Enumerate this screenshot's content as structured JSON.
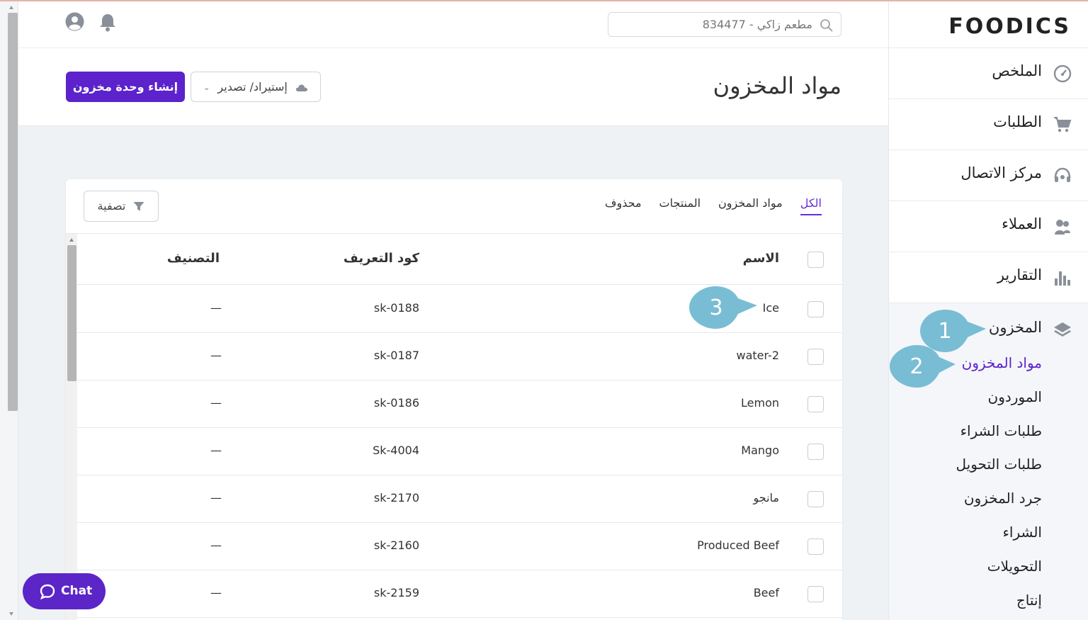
{
  "app": {
    "logo": "FOODICS",
    "search_value": "مطعم زاكي - 834477"
  },
  "page": {
    "title": "مواد المخزون",
    "create_button": "إنشاء وحدة مخزون",
    "import_export_button": "إستيراد/ تصدير",
    "filter_button": "تصفية"
  },
  "tabs": [
    {
      "label": "الكل",
      "active": true
    },
    {
      "label": "مواد المخزون",
      "active": false
    },
    {
      "label": "المنتجات",
      "active": false
    },
    {
      "label": "محذوف",
      "active": false
    }
  ],
  "table": {
    "columns": {
      "name": "الاسم",
      "sku": "كود التعريف",
      "category": "التصنيف"
    },
    "rows": [
      {
        "name": "Ice",
        "sku": "sk-0188",
        "category": "—"
      },
      {
        "name": "water-2",
        "sku": "sk-0187",
        "category": "—"
      },
      {
        "name": "Lemon",
        "sku": "sk-0186",
        "category": "—"
      },
      {
        "name": "Mango",
        "sku": "Sk-4004",
        "category": "—"
      },
      {
        "name": "مانجو",
        "sku": "sk-2170",
        "category": "—"
      },
      {
        "name": "Produced Beef",
        "sku": "sk-2160",
        "category": "—"
      },
      {
        "name": "Beef",
        "sku": "sk-2159",
        "category": "—"
      }
    ]
  },
  "sidebar": {
    "items": [
      {
        "label": "الملخص",
        "icon": "dashboard-icon"
      },
      {
        "label": "الطلبات",
        "icon": "cart-icon"
      },
      {
        "label": "مركز الاتصال",
        "icon": "headset-icon"
      },
      {
        "label": "العملاء",
        "icon": "customers-icon"
      },
      {
        "label": "التقارير",
        "icon": "reports-icon"
      }
    ],
    "inventory": {
      "label": "المخزون",
      "icon": "layers-icon",
      "subitems": [
        {
          "label": "مواد المخزون",
          "active": true
        },
        {
          "label": "الموردون",
          "active": false
        },
        {
          "label": "طلبات الشراء",
          "active": false
        },
        {
          "label": "طلبات التحويل",
          "active": false
        },
        {
          "label": "جرد المخزون",
          "active": false
        },
        {
          "label": "الشراء",
          "active": false
        },
        {
          "label": "التحويلات",
          "active": false
        },
        {
          "label": "إنتاج",
          "active": false
        }
      ]
    }
  },
  "callouts": [
    "1",
    "2",
    "3"
  ],
  "chat": {
    "label": "Chat"
  },
  "colors": {
    "accent": "#5c22cc",
    "callout": "#79bdd4"
  }
}
